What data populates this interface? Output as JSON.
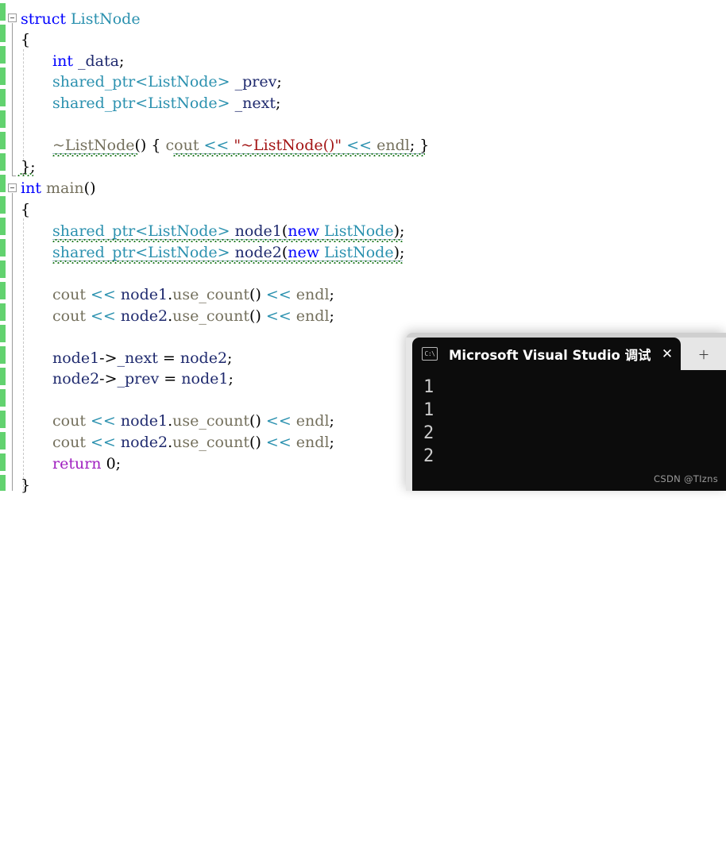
{
  "editor": {
    "language": "cpp",
    "font_size_px": 19,
    "background": "#ffffff",
    "change_margin_color": "#62d26f",
    "lines": [
      {
        "n": 1,
        "indent": 0,
        "text": "struct ListNode"
      },
      {
        "n": 2,
        "indent": 0,
        "text": "{"
      },
      {
        "n": 3,
        "indent": 1,
        "text": "int _data;"
      },
      {
        "n": 4,
        "indent": 1,
        "text": "shared_ptr<ListNode> _prev;"
      },
      {
        "n": 5,
        "indent": 1,
        "text": "shared_ptr<ListNode> _next;"
      },
      {
        "n": 6,
        "indent": 0,
        "text": ""
      },
      {
        "n": 7,
        "indent": 1,
        "text": "~ListNode() { cout << \"~ListNode()\" << endl; }"
      },
      {
        "n": 8,
        "indent": 0,
        "text": "};"
      },
      {
        "n": 9,
        "indent": 0,
        "text": "int main()"
      },
      {
        "n": 10,
        "indent": 0,
        "text": "{"
      },
      {
        "n": 11,
        "indent": 0,
        "text": ""
      },
      {
        "n": 12,
        "indent": 1,
        "text": "shared_ptr<ListNode> node1(new ListNode);"
      },
      {
        "n": 13,
        "indent": 1,
        "text": "shared_ptr<ListNode> node2(new ListNode);"
      },
      {
        "n": 14,
        "indent": 0,
        "text": ""
      },
      {
        "n": 15,
        "indent": 1,
        "text": "cout << node1.use_count() << endl;"
      },
      {
        "n": 16,
        "indent": 1,
        "text": "cout << node2.use_count() << endl;"
      },
      {
        "n": 17,
        "indent": 0,
        "text": ""
      },
      {
        "n": 18,
        "indent": 1,
        "text": "node1->_next = node2;"
      },
      {
        "n": 19,
        "indent": 1,
        "text": "node2->_prev = node1;"
      },
      {
        "n": 20,
        "indent": 0,
        "text": ""
      },
      {
        "n": 21,
        "indent": 1,
        "text": "cout << node1.use_count() << endl;"
      },
      {
        "n": 22,
        "indent": 1,
        "text": "cout << node2.use_count() << endl;"
      },
      {
        "n": 23,
        "indent": 1,
        "text": "return 0;"
      },
      {
        "n": 24,
        "indent": 0,
        "text": "}"
      }
    ],
    "tokens": {
      "struct": "struct",
      "listnode": "ListNode",
      "brace_open": "{",
      "brace_close": "}",
      "int": "int",
      "_data": "_data",
      "shared_ptr": "shared_ptr",
      "angle_open": "<",
      "angle_close": ">",
      "_prev": "_prev",
      "_next": "_next",
      "dtor": "~ListNode",
      "parens": "()",
      "cout": "cout",
      "shift": "<<",
      "dtor_string": "\"~ListNode()\"",
      "endl": "endl",
      "semicolon": ";",
      "close_semi": "};",
      "main": "main",
      "new": "new",
      "node1": "node1",
      "node2": "node2",
      "use_count": "use_count",
      "arrow": "->",
      "assign": "=",
      "return": "return",
      "zero": "0"
    },
    "colors": {
      "keyword": "#0000ff",
      "control_keyword": "#a020c0",
      "type": "#2b91af",
      "identifier": "#1f2a6e",
      "function": "#74705d",
      "string": "#a31515",
      "plain": "#000000",
      "error_squiggle": "#c0392b",
      "warning_squiggle": "#1f7a1f"
    },
    "fold_markers": [
      {
        "line": 1,
        "state": "expanded"
      },
      {
        "line": 9,
        "state": "expanded"
      }
    ]
  },
  "console": {
    "title": "Microsoft Visual Studio 调试控",
    "icon": "console-cmd-icon",
    "icon_glyph": "C:\\",
    "close_label": "✕",
    "new_tab_label": "＋",
    "background": "#0c0c0c",
    "text_color": "#cccccc",
    "output": [
      "1",
      "1",
      "2",
      "2"
    ]
  },
  "watermark": {
    "text": "CSDN @TIzns"
  }
}
